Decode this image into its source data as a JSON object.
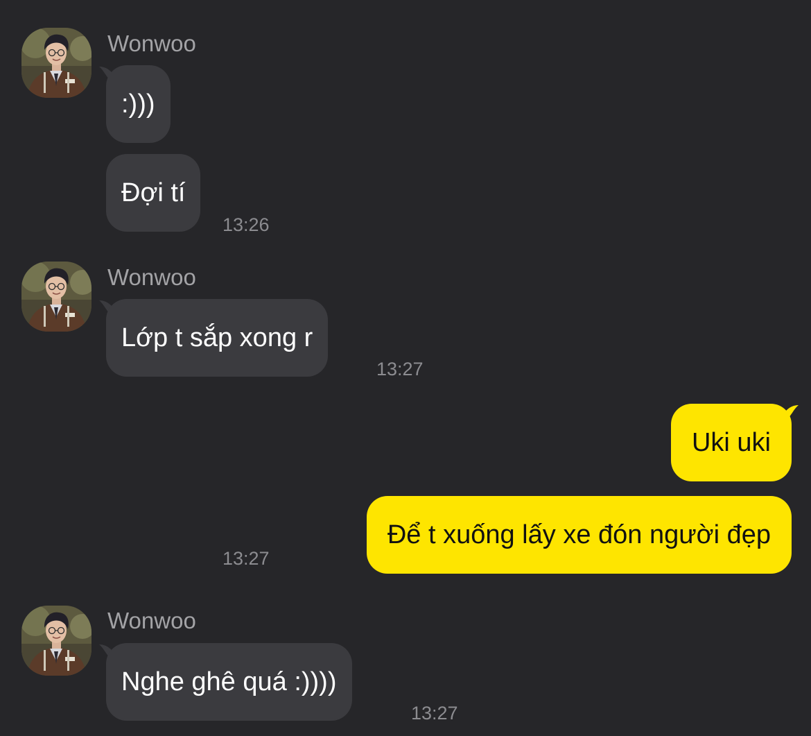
{
  "colors": {
    "background": "#262629",
    "incoming_bubble": "#3b3b3f",
    "outgoing_bubble": "#fee500",
    "name_text": "#a3a3a6",
    "time_text": "#8c8c90"
  },
  "groups": [
    {
      "sender": "Wonwoo",
      "avatar_icon": "profile-photo-avatar",
      "messages": [
        ":)))",
        "Đợi tí"
      ],
      "time": "13:26"
    },
    {
      "sender": "Wonwoo",
      "avatar_icon": "profile-photo-avatar",
      "messages": [
        "Lớp t sắp xong r"
      ],
      "time": "13:27"
    },
    {
      "sender": "me",
      "messages": [
        "Uki uki",
        "Để t xuống lấy xe đón người đẹp"
      ],
      "time": "13:27"
    },
    {
      "sender": "Wonwoo",
      "avatar_icon": "profile-photo-avatar",
      "messages": [
        "Nghe ghê quá :))))"
      ],
      "time": "13:27"
    }
  ]
}
